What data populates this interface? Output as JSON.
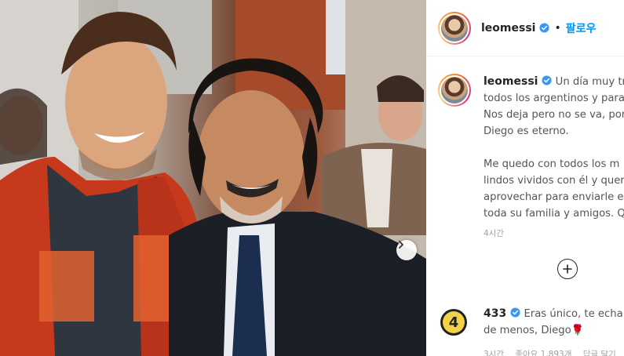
{
  "post": {
    "username": "leomessi",
    "follow_label": "팔로우",
    "separator": "•",
    "caption_lines": [
      "Un día muy tris",
      "todos los argentinos y para",
      "Nos deja pero no se va, por",
      "Diego es eterno."
    ],
    "caption_lines_2": [
      "Me quedo con todos los m",
      "lindos vividos con él y quer",
      "aprovechar para enviarle el",
      "toda su familia y amigos. Q"
    ],
    "time_ago": "4시간"
  },
  "comment": {
    "username": "433",
    "avatar_label": "4",
    "text_line1": "Eras único, te echare",
    "text_line2": "de menos, Diego",
    "emoji": "🌹",
    "time_ago": "3시간",
    "likes": "좋아요 1,893개",
    "reply": "답글 달기"
  },
  "colors": {
    "accent": "#0095f6",
    "verified": "#3897f0",
    "text": "#262626",
    "muted": "#a0a0a0"
  },
  "icons": {
    "next": "chevron-right-icon",
    "load_more": "plus-circle-icon",
    "verified": "verified-badge-icon"
  }
}
